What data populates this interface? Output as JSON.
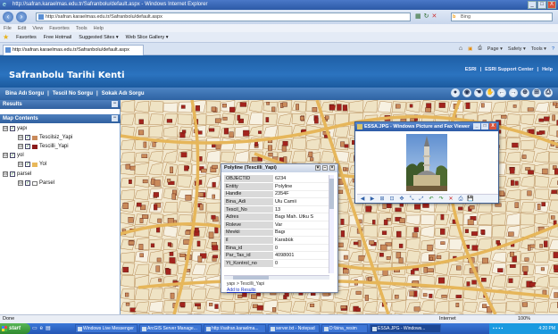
{
  "browser": {
    "title": "http://safran.karaelmas.edu.tr/Safranbolu/default.aspx - Windows Internet Explorer",
    "url": "http://safran.karaelmas.edu.tr/Safranbolu/default.aspx",
    "search_placeholder": "Bing",
    "menu": [
      "File",
      "Edit",
      "View",
      "Favorites",
      "Tools",
      "Help"
    ],
    "favorites_label": "Favorites",
    "favorites_items": [
      "Free Hotmail",
      "Suggested Sites ▾",
      "Web Slice Gallery ▾"
    ],
    "tab_label": "http://safran.karaelmas.edu.tr/Safranbolu/default.aspx",
    "cmd_items": [
      "Page ▾",
      "Safety ▾",
      "Tools ▾"
    ],
    "win_min": "_",
    "win_max": "□",
    "win_close": "X"
  },
  "app": {
    "title": "Safranbolu Tarihi Kenti",
    "header_links": [
      "ESRI",
      "ESRI Support Center",
      "Help"
    ],
    "query_links": [
      "Bina Adı Sorgu",
      "Tescil No Sorgu",
      "Sokak Adı Sorgu"
    ],
    "query_sep": "|",
    "tools": [
      "●",
      "◉",
      "☚",
      "✋",
      "←",
      "→",
      "⊕",
      "⊞",
      "⎙"
    ]
  },
  "left_panel": {
    "results_header": "Results",
    "map_contents_header": "Map Contents",
    "toggle": "−",
    "layers": [
      {
        "name": "yapı",
        "level": 0
      },
      {
        "name": "Tescilsiz_Yapi",
        "level": 1,
        "swatch": "#c98a5a"
      },
      {
        "name": "Tescilli_Yapi",
        "level": 1,
        "swatch": "#8b1a1a"
      },
      {
        "name": "yol",
        "level": 0
      },
      {
        "name": "Yol",
        "level": 1,
        "swatch": "#e8b85a"
      },
      {
        "name": "parsel",
        "level": 0
      },
      {
        "name": "Parsel",
        "level": 1,
        "swatch": "#ffffff"
      }
    ],
    "plus": "⊟",
    "check": "✓"
  },
  "identify": {
    "title": "Polyline (Tescilli_Yapi)",
    "rows": [
      [
        "OBJECTID",
        "6234"
      ],
      [
        "Entity",
        "Polyline"
      ],
      [
        "Handle",
        "2354F"
      ],
      [
        "Bina_Adi",
        "Ulu Camii"
      ],
      [
        "Tescil_No",
        "13"
      ],
      [
        "Adres",
        "Bagı Mah. Utku S"
      ],
      [
        "Roleve",
        "Var"
      ],
      [
        "Mevkii",
        "Bagı"
      ],
      [
        "il",
        "Karabük"
      ],
      [
        "Bina_id",
        "0"
      ],
      [
        "Par_Tas_id",
        "4098001"
      ],
      [
        "Yt_Kontrol_no",
        "0"
      ]
    ],
    "footer_text": "yapı > Tescilli_Yapi",
    "add_link": "Add to Results",
    "ctl": [
      "▾",
      "−",
      "×"
    ]
  },
  "viewer": {
    "title": "ESSA.JPG - Windows Picture and Fax Viewer",
    "tools": [
      "◀",
      "▶",
      "⊞",
      "⊡",
      "✥",
      "⤡",
      "⤢",
      "↶",
      "↷",
      "✕",
      "⎙",
      "💾"
    ],
    "ctl": [
      "_",
      "□",
      "X"
    ]
  },
  "status": {
    "left": "Done",
    "zone": "Internet",
    "zoom": "100%"
  },
  "taskbar": {
    "start": "start",
    "tasks": [
      "Windows Live Messenger",
      "ArcGIS Server Manage...",
      "http://safran.karaelma...",
      "server.txt - Notepad",
      "D:\\bina_resim",
      "ESSA.JPG - Windows..."
    ],
    "clock": "4:20 PM"
  }
}
